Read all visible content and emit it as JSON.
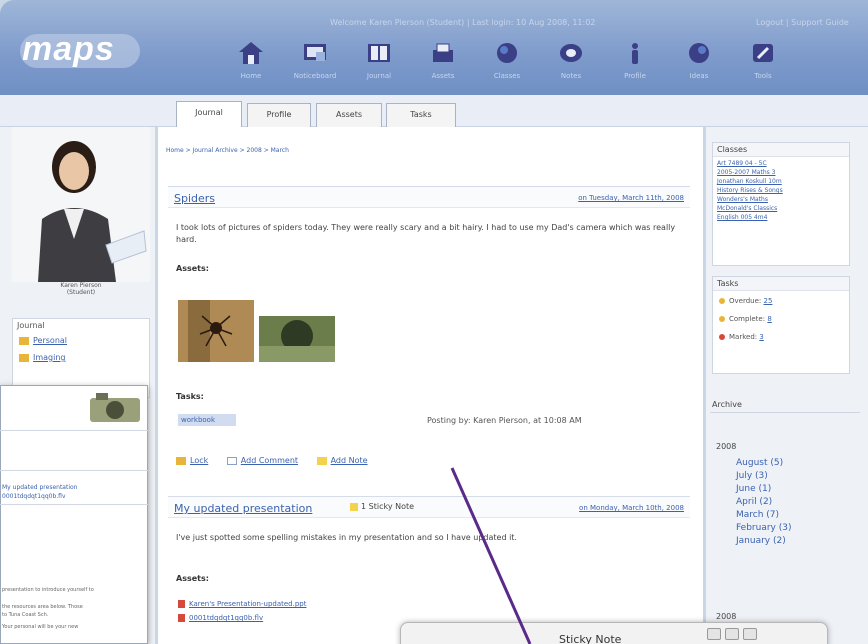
{
  "brand": {
    "logo_text": "maps",
    "accent": "#7d9acb",
    "link_color": "#3b62b0"
  },
  "header": {
    "top_info": "Welcome Karen Pierson (Student) | Last login: 10 Aug 2008, 11:02",
    "logout": "Logout | Support Guide"
  },
  "nav": [
    {
      "label": "Home",
      "icon": "home-icon"
    },
    {
      "label": "Noticeboard",
      "icon": "noticeboard-icon"
    },
    {
      "label": "Journal",
      "icon": "journal-icon"
    },
    {
      "label": "Assets",
      "icon": "assets-icon"
    },
    {
      "label": "Classes",
      "icon": "classes-icon"
    },
    {
      "label": "Notes",
      "icon": "notes-icon"
    },
    {
      "label": "Profile",
      "icon": "profile-icon"
    },
    {
      "label": "Ideas",
      "icon": "ideas-icon"
    },
    {
      "label": "Tools",
      "icon": "tools-icon"
    }
  ],
  "tabs": [
    "Journal",
    "Profile",
    "Assets",
    "Tasks"
  ],
  "active_tab": "Journal",
  "breadcrumb": "Home > Journal Archive > 2008 > March",
  "user": {
    "name": "Karen Pierson",
    "role": "(Student)"
  },
  "left_journal": {
    "heading": "Journal",
    "items": [
      "Personal",
      "Imaging"
    ]
  },
  "left_popup": {
    "line1": "My updated presentation",
    "line2": "0001tdqdqt1qq0b.flv",
    "para1": "presentation to introduce yourself to",
    "para2": "the resources area below. Those",
    "para3": "to Tuna Coast Sch.",
    "para4": "Your personal will be your new"
  },
  "entries": [
    {
      "title": "Spiders",
      "date": "on Tuesday, March 11th, 2008",
      "text": "I took lots of pictures of spiders today. They were really scary and a bit hairy. I had to use my Dad's camera which was really hard.",
      "assets_label": "Assets:",
      "tasks_label": "Tasks:",
      "task_chip": "workbook",
      "posting": "Posting by: Karen Pierson, at 10:08 AM",
      "actions": [
        "Lock",
        "Add Comment",
        "Add Note"
      ]
    },
    {
      "title": "My updated presentation",
      "sticky_count": "1 Sticky Note",
      "date": "on Monday, March 10th, 2008",
      "text": "I've just spotted some spelling mistakes in my presentation and so I have updated it.",
      "assets_label": "Assets:",
      "files": [
        "Karen's Presentation-updated.ppt",
        "0001tdqdqt1qq0b.flv"
      ]
    }
  ],
  "right": {
    "classes_heading": "Classes",
    "classes": [
      "Art 7489 04 - 5C",
      "2005-2007 Maths 3",
      "Jonathan Koskull 10m",
      "History Rises & Songs",
      "Wonders's Maths",
      "McDonald's Classics",
      "English 005 4m4"
    ],
    "tasks_heading": "Tasks",
    "tasks": [
      {
        "label": "Overdue:",
        "count": "25",
        "color": "#e8b53b"
      },
      {
        "label": "Complete:",
        "count": "8",
        "color": "#e8b53b"
      },
      {
        "label": "Marked:",
        "count": "3",
        "color": "#d4493b"
      }
    ],
    "archive_heading": "Archive",
    "years": [
      {
        "year": "2008",
        "months": [
          "August (5)",
          "July (3)",
          "June (1)",
          "April (2)",
          "March (7)",
          "February (3)",
          "January (2)"
        ]
      },
      {
        "year": "2008",
        "months": []
      }
    ]
  },
  "sticky_popup": {
    "title": "Sticky Note"
  }
}
